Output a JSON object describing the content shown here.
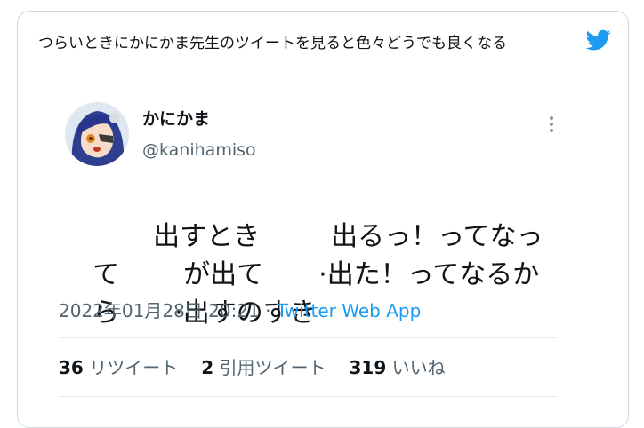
{
  "quote": {
    "text": "つらいときにかにかま先生のツイートを見ると色々どうでも良くなる"
  },
  "icons": {
    "twitter": "twitter-bird-icon",
    "more": "more-vertical-icon"
  },
  "colors": {
    "brand": "#1d9bf0",
    "text": "#0f1419",
    "secondary": "#536471",
    "border": "#cfd9de"
  },
  "tweet": {
    "display_name": "かにかま",
    "handle": "@kanihamiso",
    "lines": [
      [
        "",
        "出すとき",
        "出るっ！ってなっ"
      ],
      [
        "て",
        "が出て",
        "·出た！ってなるか"
      ],
      [
        "ら",
        "·出すのすき"
      ]
    ],
    "date": "2022年01月28日 20:21",
    "separator": " · ",
    "app": "Twitter Web App",
    "stats": {
      "retweets_count": "36",
      "retweets_label": "リツイート",
      "quotes_count": "2",
      "quotes_label": "引用ツイート",
      "likes_count": "319",
      "likes_label": "いいね"
    }
  }
}
